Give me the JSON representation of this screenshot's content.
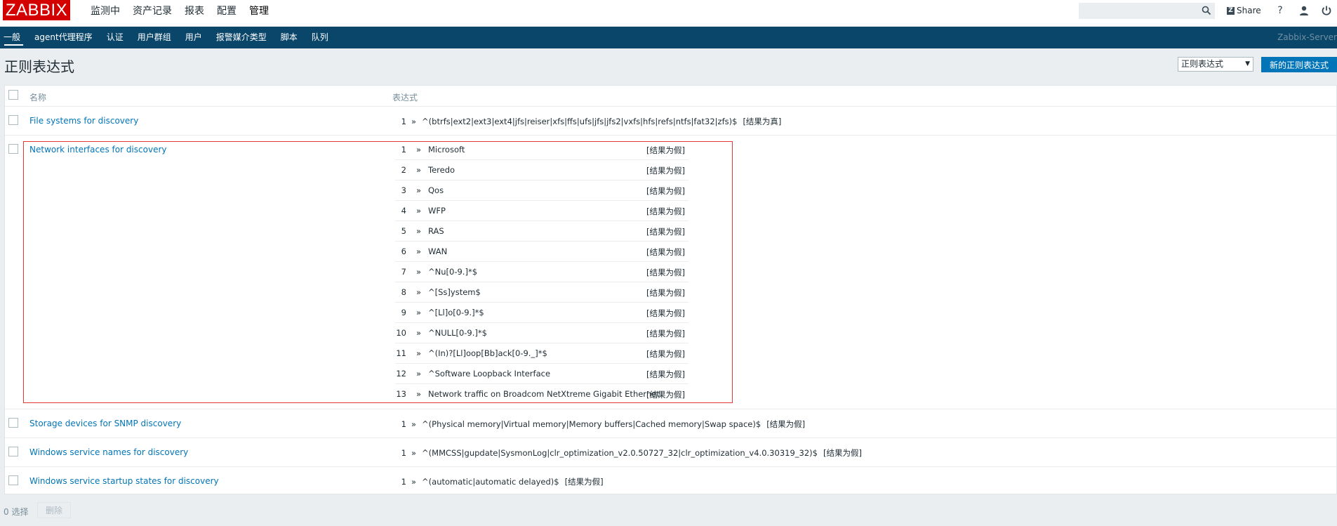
{
  "app": {
    "logo": "ZABBIX"
  },
  "main_nav": [
    {
      "label": "监测中"
    },
    {
      "label": "资产记录"
    },
    {
      "label": "报表"
    },
    {
      "label": "配置"
    },
    {
      "label": "管理",
      "active": true
    }
  ],
  "header": {
    "search_value": "",
    "share_label": "Share",
    "help_glyph": "?"
  },
  "sub_nav": [
    {
      "label": "一般",
      "active": true
    },
    {
      "label": "agent代理程序"
    },
    {
      "label": "认证"
    },
    {
      "label": "用户群组"
    },
    {
      "label": "用户"
    },
    {
      "label": "报警媒介类型"
    },
    {
      "label": "脚本"
    },
    {
      "label": "队列"
    }
  ],
  "server_name": "Zabbix-Server",
  "page": {
    "title": "正则表达式",
    "select_value": "正则表达式",
    "new_button": "新的正则表达式"
  },
  "table": {
    "col_name": "名称",
    "col_expr": "表达式",
    "rows": [
      {
        "name": "File systems for discovery",
        "expressions": [
          {
            "n": "1",
            "arrow": "»",
            "pattern": "^(btrfs|ext2|ext3|ext4|jfs|reiser|xfs|ffs|ufs|jfs|jfs2|vxfs|hfs|refs|ntfs|fat32|zfs)$",
            "result": "[结果为真]"
          }
        ]
      },
      {
        "name": "Network interfaces for discovery",
        "expressions": [
          {
            "n": "1",
            "arrow": "»",
            "pattern": "Microsoft",
            "result": "[结果为假]"
          },
          {
            "n": "2",
            "arrow": "»",
            "pattern": "Teredo",
            "result": "[结果为假]"
          },
          {
            "n": "3",
            "arrow": "»",
            "pattern": "Qos",
            "result": "[结果为假]"
          },
          {
            "n": "4",
            "arrow": "»",
            "pattern": "WFP",
            "result": "[结果为假]"
          },
          {
            "n": "5",
            "arrow": "»",
            "pattern": "RAS",
            "result": "[结果为假]"
          },
          {
            "n": "6",
            "arrow": "»",
            "pattern": "WAN",
            "result": "[结果为假]"
          },
          {
            "n": "7",
            "arrow": "»",
            "pattern": "^Nu[0-9.]*$",
            "result": "[结果为假]"
          },
          {
            "n": "8",
            "arrow": "»",
            "pattern": "^[Ss]ystem$",
            "result": "[结果为假]"
          },
          {
            "n": "9",
            "arrow": "»",
            "pattern": "^[Ll]o[0-9.]*$",
            "result": "[结果为假]"
          },
          {
            "n": "10",
            "arrow": "»",
            "pattern": "^NULL[0-9.]*$",
            "result": "[结果为假]"
          },
          {
            "n": "11",
            "arrow": "»",
            "pattern": "^(In)?[Ll]oop[Bb]ack[0-9._]*$",
            "result": "[结果为假]"
          },
          {
            "n": "12",
            "arrow": "»",
            "pattern": "^Software Loopback Interface",
            "result": "[结果为假]"
          },
          {
            "n": "13",
            "arrow": "»",
            "pattern": "Network traffic on Broadcom NetXtreme Gigabit Ethernet",
            "result": "[结果为假]"
          }
        ]
      },
      {
        "name": "Storage devices for SNMP discovery",
        "expressions": [
          {
            "n": "1",
            "arrow": "»",
            "pattern": "^(Physical memory|Virtual memory|Memory buffers|Cached memory|Swap space)$",
            "result": "[结果为假]"
          }
        ]
      },
      {
        "name": "Windows service names for discovery",
        "expressions": [
          {
            "n": "1",
            "arrow": "»",
            "pattern": "^(MMCSS|gupdate|SysmonLog|clr_optimization_v2.0.50727_32|clr_optimization_v4.0.30319_32)$",
            "result": "[结果为假]"
          }
        ]
      },
      {
        "name": "Windows service startup states for discovery",
        "expressions": [
          {
            "n": "1",
            "arrow": "»",
            "pattern": "^(automatic|automatic delayed)$",
            "result": "[结果为假]"
          }
        ]
      }
    ]
  },
  "footer": {
    "selected": "0 选择",
    "delete_button": "删除"
  }
}
